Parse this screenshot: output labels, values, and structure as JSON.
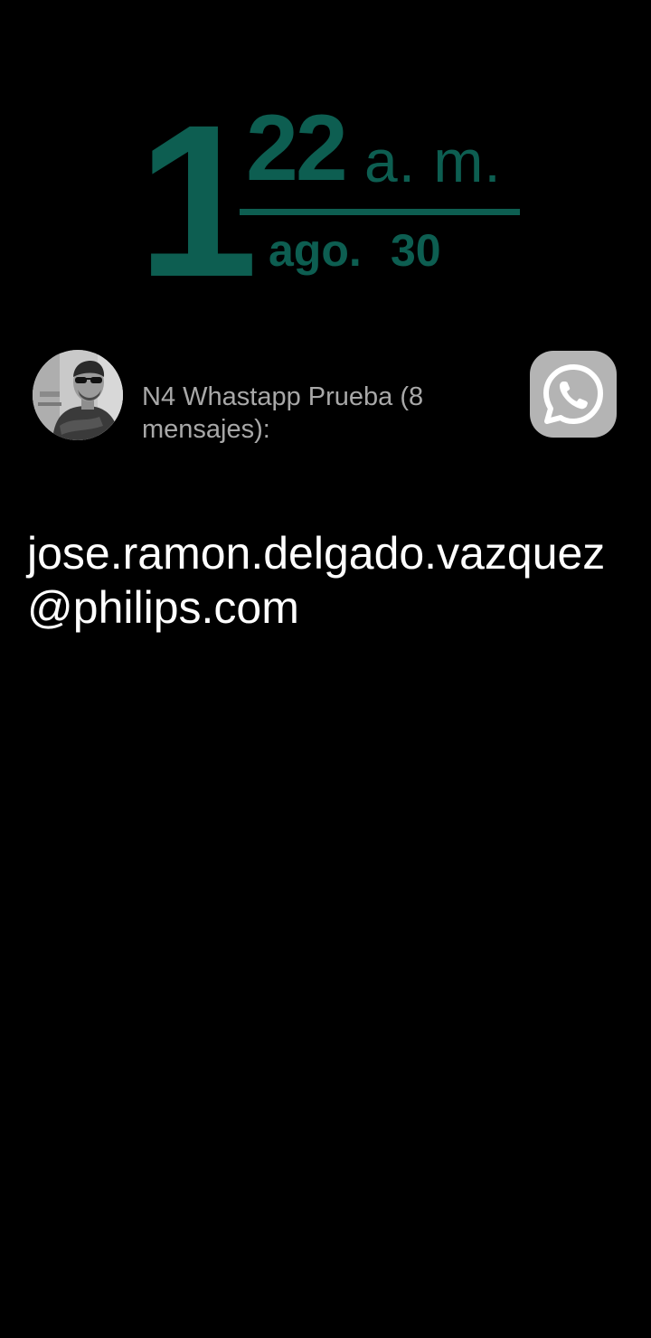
{
  "clock": {
    "hour": "1",
    "minute": "22",
    "ampm": "a. m.",
    "month": "ago.",
    "day": "30",
    "accent_color": "#0d5e51"
  },
  "notification": {
    "avatar_icon": "contact-photo",
    "title": "N4 Whastapp Prueba (8 mensajes):",
    "app_icon": "whatsapp-icon",
    "message": "jose.ramon.delgado.vazquez@philips.com"
  }
}
